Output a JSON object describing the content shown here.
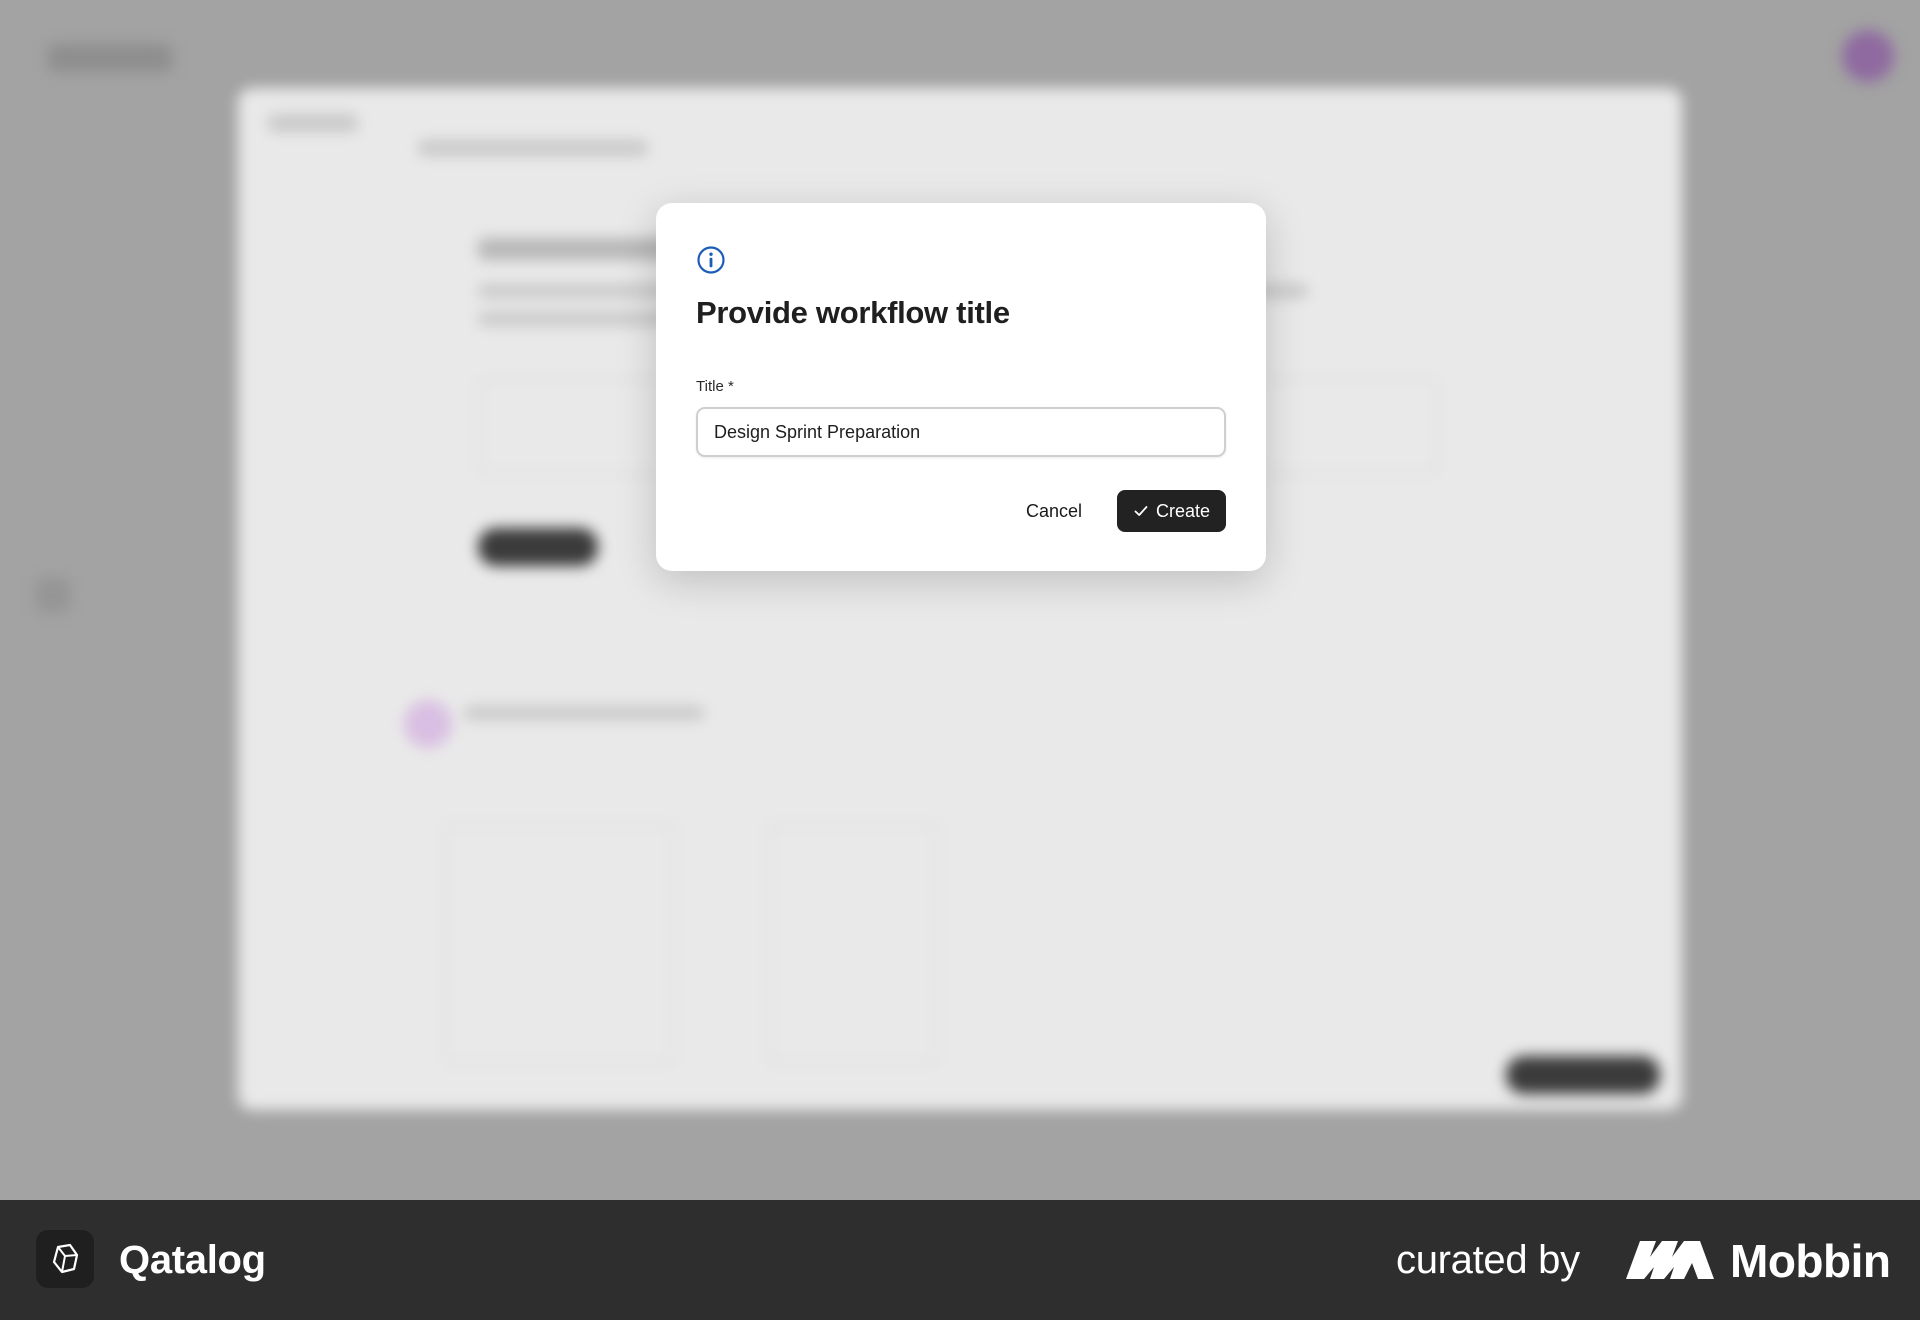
{
  "modal": {
    "icon": "info-icon",
    "title": "Provide workflow title",
    "field_label": "Title *",
    "input_value": "Design Sprint Preparation",
    "cancel_label": "Cancel",
    "create_label": "Create",
    "create_icon": "check-icon"
  },
  "footer": {
    "brand_icon": "qatalog-logo-icon",
    "brand_name": "Qatalog",
    "curated_by": "curated by",
    "curator_icon": "mobbin-logo-icon",
    "curator_name": "Mobbin"
  },
  "colors": {
    "accent": "#1a5cb8",
    "button_dark": "#222222",
    "footer_bg": "#2e2e2e",
    "overlay": "#a3a3a3"
  }
}
